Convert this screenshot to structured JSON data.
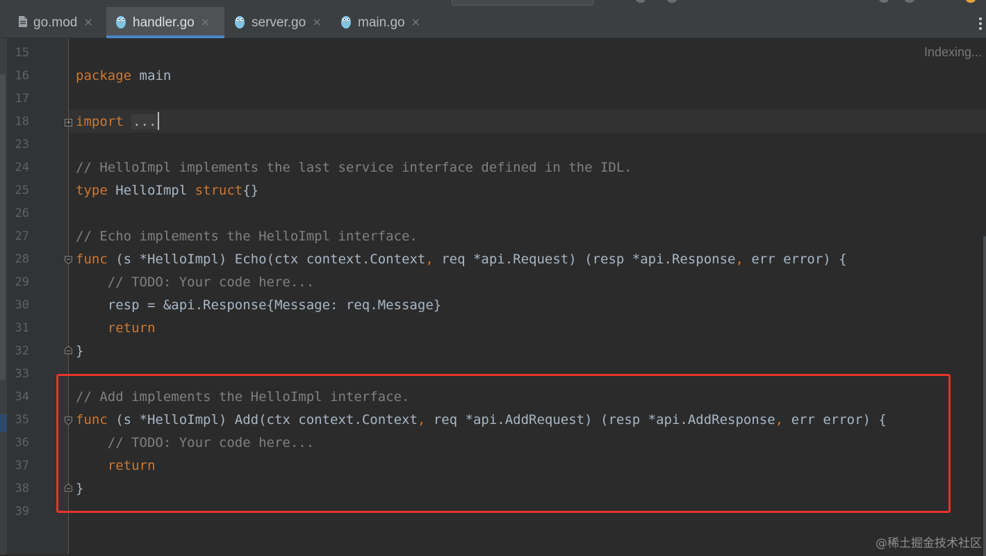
{
  "tabs": [
    {
      "label": "go.mod",
      "icon": "file-icon",
      "active": false
    },
    {
      "label": "handler.go",
      "icon": "gopher-icon",
      "active": true
    },
    {
      "label": "server.go",
      "icon": "gopher-icon",
      "active": false
    },
    {
      "label": "main.go",
      "icon": "gopher-icon",
      "active": false
    }
  ],
  "tab_close_glyph": "×",
  "status": {
    "indexing": "Indexing..."
  },
  "lines": [
    {
      "num": "15",
      "text": ""
    },
    {
      "num": "16",
      "kw": "package",
      "rest": " main"
    },
    {
      "num": "17",
      "text": ""
    },
    {
      "num": "18",
      "kw": "import",
      "rest": " ",
      "ellipsis": "..."
    },
    {
      "num": "23",
      "text": ""
    },
    {
      "num": "24",
      "comment": "// HelloImpl implements the last service interface defined in the IDL."
    },
    {
      "num": "25",
      "kw": "type",
      "mid": " HelloImpl ",
      "kw2": "struct",
      "rest": "{}"
    },
    {
      "num": "26",
      "text": ""
    },
    {
      "num": "27",
      "comment": "// Echo implements the HelloImpl interface."
    },
    {
      "num": "28",
      "kw": "func",
      "p1": " (s *HelloImpl) Echo(ctx context.Context",
      "c1": ",",
      "p2": " req *api.Request) (resp *api.Response",
      "c2": ",",
      "p3": " err error) {"
    },
    {
      "num": "29",
      "comment": "    // TODO: Your code here..."
    },
    {
      "num": "30",
      "text": "    resp = &api.Response{Message: req.Message}"
    },
    {
      "num": "31",
      "indent": "    ",
      "kw": "return"
    },
    {
      "num": "32",
      "text": "}"
    },
    {
      "num": "33",
      "text": ""
    },
    {
      "num": "34",
      "comment": "// Add implements the HelloImpl interface."
    },
    {
      "num": "35",
      "kw": "func",
      "p1": " (s *HelloImpl) Add(ctx context.Context",
      "c1": ",",
      "p2": " req *api.AddRequest) (resp *api.AddResponse",
      "c2": ",",
      "p3": " err error) {"
    },
    {
      "num": "36",
      "comment": "    // TODO: Your code here..."
    },
    {
      "num": "37",
      "indent": "    ",
      "kw": "return"
    },
    {
      "num": "38",
      "text": "}"
    },
    {
      "num": "39",
      "text": ""
    }
  ],
  "colors": {
    "keyword": "#cc7832",
    "comment": "#808080",
    "text": "#a9b7c6",
    "highlight": "#e6342a",
    "active_tab_underline": "#4a88c7"
  },
  "watermark": "@稀土掘金技术社区"
}
